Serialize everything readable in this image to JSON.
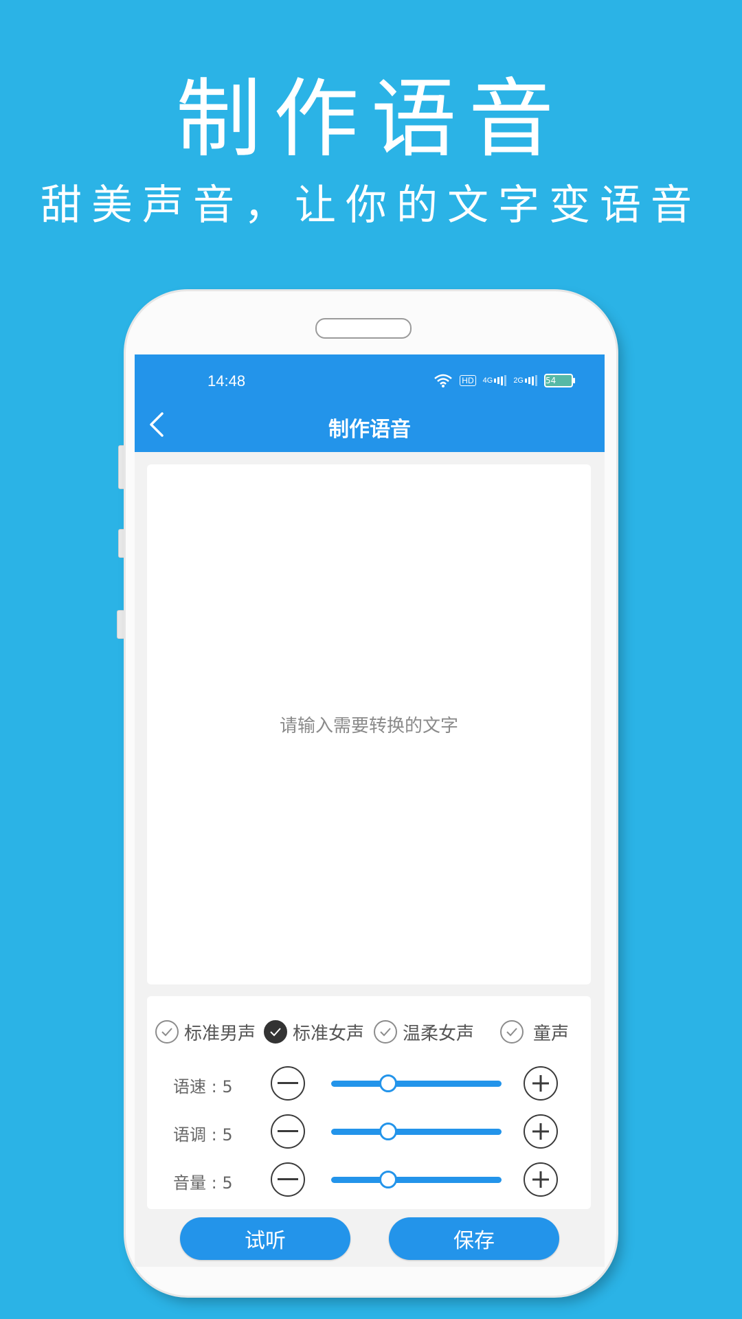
{
  "promo": {
    "title": "制作语音",
    "subtitle": "甜美声音，让你的文字变语音"
  },
  "status_bar": {
    "time": "14:48",
    "hd_label": "HD",
    "signal1_label": "4G",
    "signal2_label": "2G",
    "battery": "54"
  },
  "header": {
    "title": "制作语音",
    "back_icon": "chevron-left-icon"
  },
  "input": {
    "placeholder": "请输入需要转换的文字",
    "value": ""
  },
  "voices": [
    {
      "label": "标准男声",
      "selected": false
    },
    {
      "label": "标准女声",
      "selected": true
    },
    {
      "label": "温柔女声",
      "selected": false
    },
    {
      "label": "童声",
      "selected": false
    }
  ],
  "sliders": [
    {
      "label": "语速 : 5",
      "value": 5,
      "min": 0,
      "max": 15
    },
    {
      "label": "语调 : 5",
      "value": 5,
      "min": 0,
      "max": 15
    },
    {
      "label": "音量 : 5",
      "value": 5,
      "min": 0,
      "max": 15
    }
  ],
  "actions": {
    "listen": "试听",
    "save": "保存"
  },
  "colors": {
    "background": "#2bb3e6",
    "primary": "#2394ea",
    "check_selected": "#333333"
  }
}
